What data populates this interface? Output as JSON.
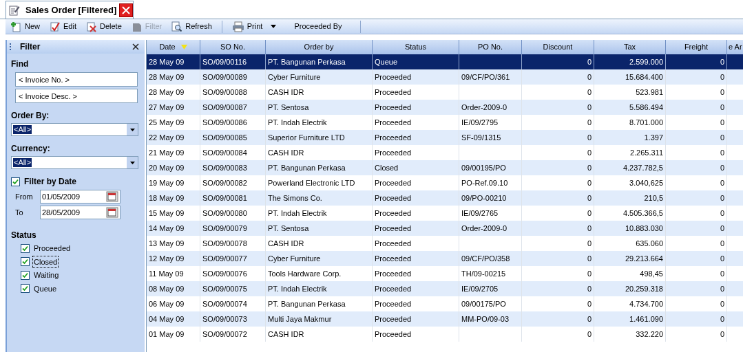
{
  "tab": {
    "title": "Sales Order [Filtered]",
    "selected": true
  },
  "toolbar": [
    {
      "kind": "button",
      "label": "New",
      "disabled": false
    },
    {
      "kind": "button",
      "label": "Edit",
      "disabled": false
    },
    {
      "kind": "button",
      "label": "Delete",
      "disabled": false
    },
    {
      "kind": "button",
      "label": "Filter",
      "disabled": true
    },
    {
      "kind": "button",
      "label": "Refresh",
      "disabled": false
    },
    {
      "kind": "separator"
    },
    {
      "kind": "dropdown",
      "label": "Print",
      "disabled": false
    },
    {
      "kind": "text",
      "label": "Proceeded By",
      "disabled": false
    },
    {
      "kind": "separator"
    }
  ],
  "filter": {
    "title": "Filter",
    "find_label": "Find",
    "find_fields": [
      {
        "placeholder": "< Invoice No. >"
      },
      {
        "placeholder": "< Invoice Desc. >"
      }
    ],
    "selects": [
      {
        "label": "Order By:",
        "value": "<All>"
      },
      {
        "label": "Currency:",
        "value": "<All>"
      }
    ],
    "filter_by_date": {
      "label": "Filter by Date",
      "checked": true
    },
    "dates": [
      {
        "label": "From",
        "value": "01/05/2009"
      },
      {
        "label": "To",
        "value": "28/05/2009"
      }
    ],
    "status_label": "Status",
    "statuses": [
      {
        "label": "Proceeded",
        "checked": true,
        "focused": false
      },
      {
        "label": "Closed",
        "checked": true,
        "focused": true
      },
      {
        "label": "Waiting",
        "checked": true,
        "focused": false
      },
      {
        "label": "Queue",
        "checked": true,
        "focused": false
      }
    ]
  },
  "table": {
    "columns": [
      {
        "label": "Date",
        "sorted": true
      },
      {
        "label": "SO No.",
        "sorted": false
      },
      {
        "label": "Order by",
        "sorted": false
      },
      {
        "label": "Status",
        "sorted": false
      },
      {
        "label": "PO No.",
        "sorted": false
      },
      {
        "label": "Discount",
        "sorted": false
      },
      {
        "label": "Tax",
        "sorted": false
      },
      {
        "label": "Freight",
        "sorted": false
      },
      {
        "label": "e Ar"
      }
    ],
    "rows": [
      {
        "selected": true,
        "cells": [
          "28 May 09",
          "SO/09/00116",
          "PT. Bangunan Perkasa",
          "Queue",
          "",
          "0",
          "2.599.000",
          "0"
        ]
      },
      {
        "selected": false,
        "cells": [
          "28 May 09",
          "SO/09/00089",
          "Cyber Furniture",
          "Proceeded",
          "09/CF/PO/361",
          "0",
          "15.684.400",
          "0"
        ]
      },
      {
        "selected": false,
        "cells": [
          "28 May 09",
          "SO/09/00088",
          "CASH IDR",
          "Proceeded",
          "",
          "0",
          "523.981",
          "0"
        ]
      },
      {
        "selected": false,
        "cells": [
          "27 May 09",
          "SO/09/00087",
          "PT. Sentosa",
          "Proceeded",
          "Order-2009-0",
          "0",
          "5.586.494",
          "0"
        ]
      },
      {
        "selected": false,
        "cells": [
          "25 May 09",
          "SO/09/00086",
          "PT. Indah Electrik",
          "Proceeded",
          "IE/09/2795",
          "0",
          "8.701.000",
          "0"
        ]
      },
      {
        "selected": false,
        "cells": [
          "22 May 09",
          "SO/09/00085",
          "Superior Furniture LTD",
          "Proceeded",
          "SF-09/1315",
          "0",
          "1.397",
          "0"
        ]
      },
      {
        "selected": false,
        "cells": [
          "21 May 09",
          "SO/09/00084",
          "CASH IDR",
          "Proceeded",
          "",
          "0",
          "2.265.311",
          "0"
        ]
      },
      {
        "selected": false,
        "cells": [
          "20 May 09",
          "SO/09/00083",
          "PT. Bangunan Perkasa",
          "Closed",
          "09/00195/PO",
          "0",
          "4.237.782,5",
          "0"
        ]
      },
      {
        "selected": false,
        "cells": [
          "19 May 09",
          "SO/09/00082",
          "Powerland Electronic LTD",
          "Proceeded",
          "PO-Ref.09.10",
          "0",
          "3.040,625",
          "0"
        ]
      },
      {
        "selected": false,
        "cells": [
          "18 May 09",
          "SO/09/00081",
          "The Simons Co.",
          "Proceeded",
          "09/PO-00210",
          "0",
          "210,5",
          "0"
        ]
      },
      {
        "selected": false,
        "cells": [
          "15 May 09",
          "SO/09/00080",
          "PT. Indah Electrik",
          "Proceeded",
          "IE/09/2765",
          "0",
          "4.505.366,5",
          "0"
        ]
      },
      {
        "selected": false,
        "cells": [
          "14 May 09",
          "SO/09/00079",
          "PT. Sentosa",
          "Proceeded",
          "Order-2009-0",
          "0",
          "10.883.030",
          "0"
        ]
      },
      {
        "selected": false,
        "cells": [
          "13 May 09",
          "SO/09/00078",
          "CASH IDR",
          "Proceeded",
          "",
          "0",
          "635.060",
          "0"
        ]
      },
      {
        "selected": false,
        "cells": [
          "12 May 09",
          "SO/09/00077",
          "Cyber Furniture",
          "Proceeded",
          "09/CF/PO/358",
          "0",
          "29.213.664",
          "0"
        ]
      },
      {
        "selected": false,
        "cells": [
          "11 May 09",
          "SO/09/00076",
          "Tools Hardware Corp.",
          "Proceeded",
          "TH/09-00215",
          "0",
          "498,45",
          "0"
        ]
      },
      {
        "selected": false,
        "cells": [
          "08 May 09",
          "SO/09/00075",
          "PT. Indah Electrik",
          "Proceeded",
          "IE/09/2705",
          "0",
          "20.259.318",
          "0"
        ]
      },
      {
        "selected": false,
        "cells": [
          "06 May 09",
          "SO/09/00074",
          "PT. Bangunan Perkasa",
          "Proceeded",
          "09/00175/PO",
          "0",
          "4.734.700",
          "0"
        ]
      },
      {
        "selected": false,
        "cells": [
          "04 May 09",
          "SO/09/00073",
          "Multi Jaya Makmur",
          "Proceeded",
          "MM-PO/09-03",
          "0",
          "1.461.090",
          "0"
        ]
      },
      {
        "selected": false,
        "cells": [
          "01 May 09",
          "SO/09/00072",
          "CASH IDR",
          "Proceeded",
          "",
          "0",
          "332.220",
          "0"
        ]
      }
    ]
  }
}
